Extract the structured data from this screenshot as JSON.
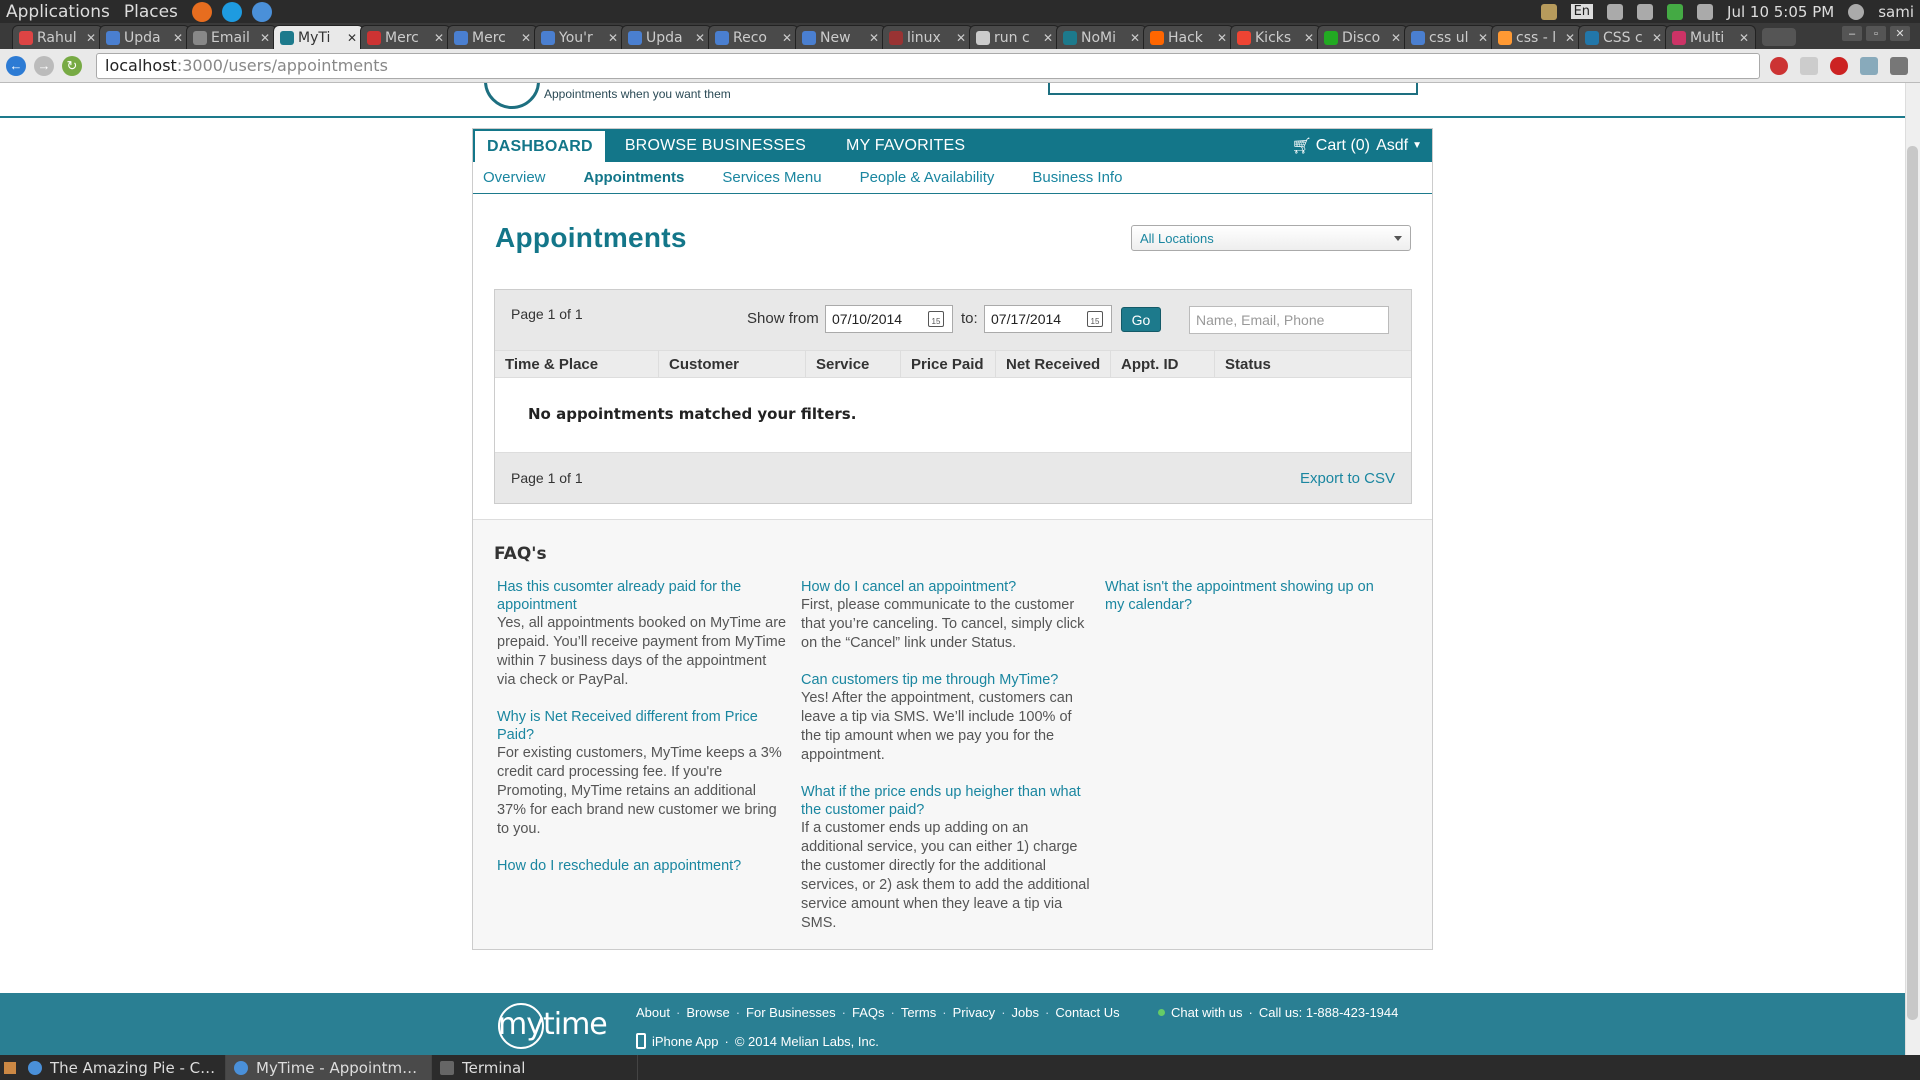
{
  "os_bar": {
    "menu": [
      "Applications",
      "Places"
    ],
    "lang": "En",
    "clock": "Jul 10  5:05 PM",
    "user": "sami"
  },
  "browser": {
    "tabs": [
      {
        "title": "Rahul",
        "color": "#d44"
      },
      {
        "title": "Upda",
        "color": "#4a7fd0"
      },
      {
        "title": "Email",
        "color": "#888"
      },
      {
        "title": "MyTi",
        "color": "#1d7a8c",
        "active": true
      },
      {
        "title": "Merc",
        "color": "#c33"
      },
      {
        "title": "Merc",
        "color": "#4a7fd0"
      },
      {
        "title": "You'r",
        "color": "#4a7fd0"
      },
      {
        "title": "Upda",
        "color": "#4a7fd0"
      },
      {
        "title": "Reco",
        "color": "#4a7fd0"
      },
      {
        "title": "New",
        "color": "#4a7fd0"
      },
      {
        "title": "linux",
        "color": "#933"
      },
      {
        "title": "run c",
        "color": "#ccc"
      },
      {
        "title": "NoMi",
        "color": "#1d7a8c"
      },
      {
        "title": "Hack",
        "color": "#f60"
      },
      {
        "title": "Kicks",
        "color": "#e43"
      },
      {
        "title": "Disco",
        "color": "#2a2"
      },
      {
        "title": "css ul",
        "color": "#4a7fd0"
      },
      {
        "title": "css - l",
        "color": "#f93"
      },
      {
        "title": "CSS c",
        "color": "#27a"
      },
      {
        "title": "Multi",
        "color": "#c36"
      }
    ],
    "url_host": "localhost",
    "url_path": ":3000/users/appointments"
  },
  "site": {
    "tagline": "Appointments when you want them",
    "nav_main": [
      "DASHBOARD",
      "BROWSE BUSINESSES",
      "MY FAVORITES"
    ],
    "cart": "Cart (0)",
    "user": "Asdf",
    "nav_sub": [
      "Overview",
      "Appointments",
      "Services Menu",
      "People & Availability",
      "Business Info"
    ]
  },
  "appointments": {
    "title": "Appointments",
    "location_select": "All Locations",
    "page_info_top": "Page 1 of 1",
    "show_from_label": "Show from",
    "date_from": "07/10/2014",
    "to_label": "to:",
    "date_to": "07/17/2014",
    "go_label": "Go",
    "search_placeholder": "Name, Email, Phone",
    "columns": [
      "Time & Place",
      "Customer",
      "Service",
      "Price Paid",
      "Net Received",
      "Appt. ID",
      "Status"
    ],
    "empty_message": "No appointments matched your filters.",
    "page_info_bottom": "Page 1 of 1",
    "export_label": "Export to CSV"
  },
  "faq": {
    "title": "FAQ's",
    "col1": [
      {
        "q": "Has this cusomter already paid for the appointment",
        "a": "Yes, all appointments booked on MyTime are prepaid. You’ll receive payment from MyTime within 7 business days of the appointment via check or PayPal."
      },
      {
        "q": "Why is Net Received different from Price Paid?",
        "a": "For existing customers, MyTime keeps a 3% credit card processing fee. If you're Promoting, MyTime retains an additional 37% for each brand new customer we bring to you."
      },
      {
        "q": "How do I reschedule an appointment?",
        "a": ""
      }
    ],
    "col2": [
      {
        "q": "How do I cancel an appointment?",
        "a": "First, please communicate to the customer that you’re canceling. To cancel, simply click on the “Cancel” link under Status."
      },
      {
        "q": "Can customers tip me through MyTime?",
        "a": "Yes! After the appointment, customers can leave a tip via SMS. We’ll include 100% of the tip amount when we pay you for the appointment."
      },
      {
        "q": "What if the price ends up heigher than what the customer paid?",
        "a": "If a customer ends up adding on an additional service, you can either 1) charge the customer directly for the additional services, or 2) ask them to add the additional service amount when they leave a tip via SMS."
      }
    ],
    "col3": [
      {
        "q": "What isn't the appointment showing up on my calendar?",
        "a": ""
      }
    ]
  },
  "footer": {
    "logo_text": "mytime",
    "links": [
      "About",
      "Browse",
      "For Businesses",
      "FAQs",
      "Terms",
      "Privacy",
      "Jobs",
      "Contact Us"
    ],
    "iphone": "iPhone App",
    "copyright": "© 2014 Melian Labs, Inc.",
    "chat": "Chat with us",
    "call": "Call us: 1-888-423-1944"
  },
  "taskbar": {
    "tasks": [
      "The Amazing Pie - Chr...",
      "MyTime - Appointmen...",
      "Terminal"
    ]
  },
  "colors": {
    "brand": "#137689",
    "link": "#1a86a0"
  }
}
